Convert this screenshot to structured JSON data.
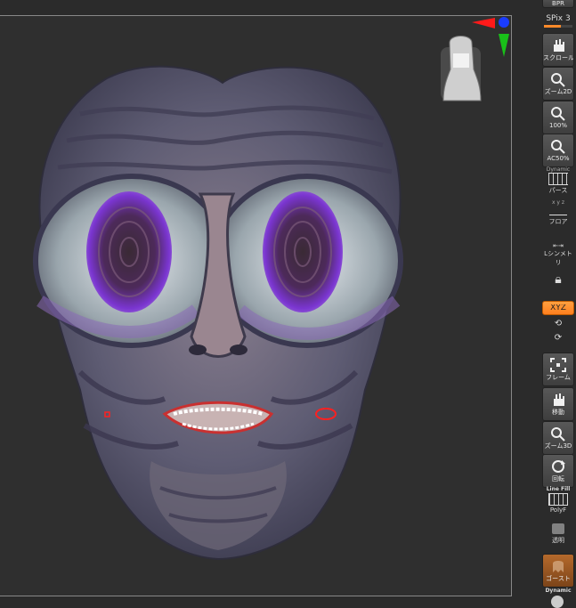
{
  "top_button": "BPR",
  "spix": {
    "label": "SPix 3",
    "level": 0.6
  },
  "tools": [
    {
      "id": "scroll",
      "label": "スクロール"
    },
    {
      "id": "zoom2d",
      "label": "ズーム2D"
    },
    {
      "id": "actual",
      "label": "100%"
    },
    {
      "id": "aahalf",
      "label": "AC50%"
    },
    {
      "id": "persp",
      "label": "パース",
      "caption": "Dynamic"
    },
    {
      "id": "floor",
      "label": "フロア",
      "caption": "x y z"
    },
    {
      "id": "lsym",
      "label": "Lシンメトリ"
    },
    {
      "id": "lock",
      "label": ""
    },
    {
      "id": "frame",
      "label": "フレーム"
    },
    {
      "id": "move",
      "label": "移動"
    },
    {
      "id": "zoom3d",
      "label": "ズーム3D"
    },
    {
      "id": "rotate",
      "label": "回転"
    },
    {
      "id": "polyf",
      "label": "PolyF",
      "caption": "Line Fill"
    },
    {
      "id": "transp",
      "label": "透明"
    },
    {
      "id": "ghost",
      "label": "ゴースト"
    }
  ],
  "xyz_button": "XYZ",
  "bottom_caption": "Dynamic",
  "colors": {
    "accent": "#ff8a2a",
    "face_base": "#6b6a80",
    "iris": "#6a2fb0"
  }
}
